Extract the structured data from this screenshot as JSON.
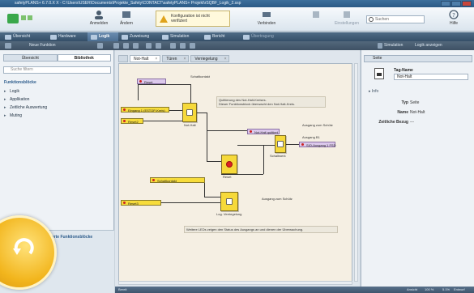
{
  "window": {
    "title": "safetyPLANS+ 6.7.0.X X - C:\\Users\\USER\\Documents\\Projekte_Safety\\CONTACT\\safetyPLANS+ Projekt\\rSQBF_Logik_2.ssp"
  },
  "ribbon": {
    "buttons": [
      {
        "label": "Anmelden"
      },
      {
        "label": "Ändern"
      },
      {
        "label": "Verbinden"
      },
      {
        "label": "Einstellungen"
      }
    ],
    "warning_line1": "Konfiguration ist nicht",
    "warning_line2": "verifiziert",
    "search_placeholder": "Suchen",
    "help_label": "Hilfe"
  },
  "nav": {
    "tabs": [
      {
        "label": "Übersicht"
      },
      {
        "label": "Hardware"
      },
      {
        "label": "Logik"
      },
      {
        "label": "Zuweisung"
      },
      {
        "label": "Simulation"
      },
      {
        "label": "Bericht"
      },
      {
        "label": "Übertragung"
      }
    ],
    "active": "Logik"
  },
  "toolbar": {
    "left_label": "Neue Funktion",
    "right_label1": "Simulation",
    "right_label2": "Logik anzeigen"
  },
  "left_panel": {
    "tabs": [
      "Übersicht",
      "Bibliothek"
    ],
    "search_placeholder": "Suche filtern",
    "section_title": "Funktionsblöcke",
    "items": [
      "Logik",
      "Applikation",
      "Zeitliche Auswertung",
      "Muting"
    ],
    "bottom_title": "Definierte Funktionsblöcke"
  },
  "editor": {
    "tabs": [
      {
        "label": "Not-Halt"
      },
      {
        "label": "Türen"
      },
      {
        "label": "Verriegelung"
      }
    ],
    "signals": {
      "reset": "Reset",
      "estop_input": "Eingang 1 (ESTOP-Kreis)",
      "reset2": "Reset2",
      "switch": "Schaltkontakt",
      "estop_ok": "Not-Halt quittiert",
      "output": "SIO-Ausgang 1 FSD",
      "reset3": "Reset3",
      "output_label": "Ausgang B1"
    },
    "blocks": {
      "b1": "Not-Halt",
      "b2": "Reset",
      "b3": "Schaltwerk",
      "b4": "Log. Verriegelung",
      "b5": "Ausgang 2"
    },
    "notes": {
      "n1": "Quittierung des Not-Halt-Kreises.",
      "n2": "Dieser Funktionsblock überwacht den Not-Halt-Kreis.",
      "n3": "Ausgang zum Schütz",
      "n4": "Ausgang zum Schütz",
      "n5": "Weitere LEDs zeigen den Status des Ausgangs an und dienen der Überwachung."
    }
  },
  "right_panel": {
    "title": "Seite",
    "tag_name_label": "Tag-Name",
    "tag_name_value": "Not-Halt",
    "info_label": "Info",
    "rows": [
      {
        "key": "Typ",
        "value": "Seite"
      },
      {
        "key": "Name",
        "value": "Not-Halt"
      },
      {
        "key": "Zeitliche Bezug",
        "value": "---"
      }
    ]
  },
  "status": {
    "left": "Bereit",
    "r1": "100 %",
    "r2": "Ansicht",
    "r3": "5.1%",
    "r4": "Entwurf"
  }
}
